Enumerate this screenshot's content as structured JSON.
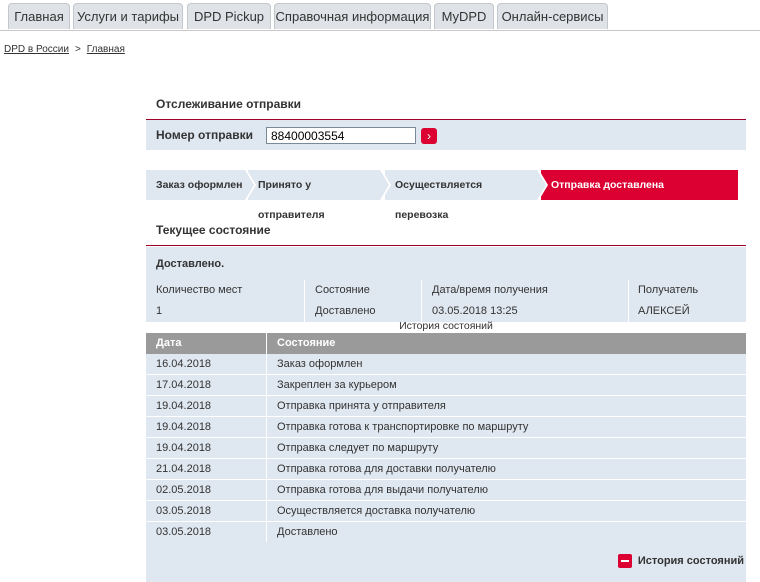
{
  "tabs": [
    "Главная",
    "Услуги и тарифы",
    "DPD Pickup",
    "Справочная информация",
    "MyDPD",
    "Онлайн-сервисы"
  ],
  "breadcrumb": {
    "root": "DPD в России",
    "separator": ">",
    "current": "Главная"
  },
  "tracking": {
    "title": "Отслеживание отправки",
    "number_label": "Номер отправки",
    "number_value": "88400003554",
    "go_icon": "chevron-right-icon"
  },
  "steps": [
    "Заказ оформлен",
    "Принято у отправителя",
    "Осуществляется перевозка",
    "Отправка доставлена"
  ],
  "current_step": 3,
  "current_status": {
    "title": "Текущее состояние",
    "status_text": "Доставлено.",
    "headers": {
      "count": "Количество мест",
      "state": "Состояние",
      "datetime": "Дата/время получения",
      "recipient": "Получатель"
    },
    "values": {
      "count": "1",
      "state": "Доставлено",
      "datetime": "03.05.2018 13:25",
      "recipient": "АЛЕКСЕЙ"
    }
  },
  "history": {
    "caption": "История состояний",
    "headers": {
      "date": "Дата",
      "state": "Состояние"
    },
    "rows": [
      {
        "date": "16.04.2018",
        "state": "Заказ оформлен"
      },
      {
        "date": "17.04.2018",
        "state": "Закреплен за курьером"
      },
      {
        "date": "19.04.2018",
        "state": "Отправка принята у отправителя"
      },
      {
        "date": "19.04.2018",
        "state": "Отправка готова к транспортировке по маршруту"
      },
      {
        "date": "19.04.2018",
        "state": "Отправка следует по маршруту"
      },
      {
        "date": "21.04.2018",
        "state": "Отправка готова для доставки получателю"
      },
      {
        "date": "02.05.2018",
        "state": "Отправка готова для выдачи получателю"
      },
      {
        "date": "03.05.2018",
        "state": "Осуществляется доставка получателю"
      },
      {
        "date": "03.05.2018",
        "state": "Доставлено"
      }
    ],
    "toggle_label": "История состояний"
  },
  "colors": {
    "accent": "#dc0032",
    "panel": "#dfe7f0",
    "header_gray": "#9a9a9a"
  }
}
